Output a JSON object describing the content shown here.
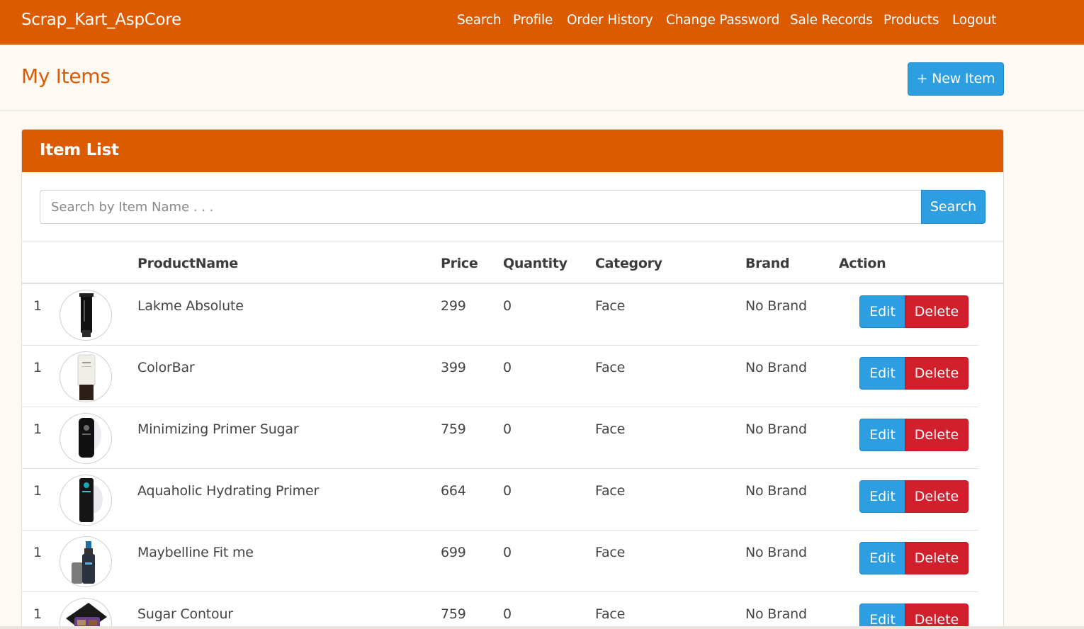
{
  "app": {
    "brand": "Scrap_Kart_AspCore"
  },
  "nav": {
    "items": [
      {
        "label": "Search"
      },
      {
        "label": "Profile"
      },
      {
        "label": "Order History"
      },
      {
        "label": "Change Password"
      },
      {
        "label": "Sale Records"
      },
      {
        "label": "Products"
      },
      {
        "label": "Logout"
      }
    ]
  },
  "page": {
    "title": "My Items",
    "new_item_label": "+ New Item"
  },
  "panel": {
    "title": "Item List",
    "search_placeholder": "Search by Item Name . . .",
    "search_label": "Search"
  },
  "table": {
    "headers": [
      "",
      "",
      "ProductName",
      "Price",
      "Quantity",
      "Category",
      "Brand",
      "Action"
    ],
    "edit_label": "Edit",
    "delete_label": "Delete",
    "rows": [
      {
        "index": "1",
        "name": "Lakme Absolute",
        "price": "299",
        "quantity": "0",
        "category": "Face",
        "brand": "No Brand",
        "image": "black-tube-product-image"
      },
      {
        "index": "1",
        "name": "ColorBar",
        "price": "399",
        "quantity": "0",
        "category": "Face",
        "brand": "No Brand",
        "image": "white-tube-product-image"
      },
      {
        "index": "1",
        "name": "Minimizing Primer Sugar",
        "price": "759",
        "quantity": "0",
        "category": "Face",
        "brand": "No Brand",
        "image": "black-pump-bottle-product-image"
      },
      {
        "index": "1",
        "name": "Aquaholic Hydrating Primer",
        "price": "664",
        "quantity": "0",
        "category": "Face",
        "brand": "No Brand",
        "image": "dark-tube-product-image"
      },
      {
        "index": "1",
        "name": "Maybelline Fit me",
        "price": "699",
        "quantity": "0",
        "category": "Face",
        "brand": "No Brand",
        "image": "spray-bottle-product-image"
      },
      {
        "index": "1",
        "name": "Sugar Contour",
        "price": "759",
        "quantity": "0",
        "category": "Face",
        "brand": "No Brand",
        "image": "contour-palette-product-image"
      }
    ]
  },
  "colors": {
    "accent": "#dc5a00",
    "primary": "#2d9ee0",
    "danger": "#d11f2c",
    "page_bg": "#fff9f3"
  }
}
